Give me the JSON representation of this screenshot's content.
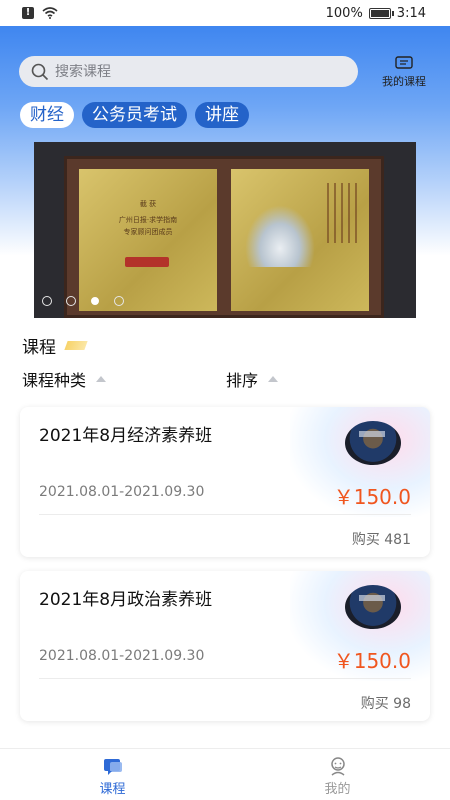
{
  "status_bar": {
    "battery": "100%",
    "time": "3:14",
    "battery_level": 1.0
  },
  "search": {
    "placeholder": "搜索课程"
  },
  "my_course": {
    "label": "我的课程"
  },
  "tabs": [
    {
      "label": "财经",
      "active": true
    },
    {
      "label": "公务员考试",
      "active": false
    },
    {
      "label": "讲座",
      "active": false
    }
  ],
  "banner": {
    "plaque_left_line1": "截 获",
    "plaque_left_line2": "广州日报·求学指南",
    "plaque_left_line3": "专家顾问团成员",
    "dots": 4,
    "active_dot": 3
  },
  "section": {
    "title": "课程"
  },
  "filters": {
    "category": "课程种类",
    "sort": "排序"
  },
  "courses": [
    {
      "title": "2021年8月经济素养班",
      "date": "2021.08.01-2021.09.30",
      "price": "￥150.0",
      "sold": "购买 481"
    },
    {
      "title": "2021年8月政治素养班",
      "date": "2021.08.01-2021.09.30",
      "price": "￥150.0",
      "sold": "购买 98"
    }
  ],
  "bottom_nav": [
    {
      "label": "课程",
      "active": true,
      "icon": "course-icon"
    },
    {
      "label": "我的",
      "active": false,
      "icon": "profile-icon"
    }
  ],
  "colors": {
    "accent": "#2463c9",
    "price": "#f0561f",
    "nav_active": "#2e6ad6"
  }
}
